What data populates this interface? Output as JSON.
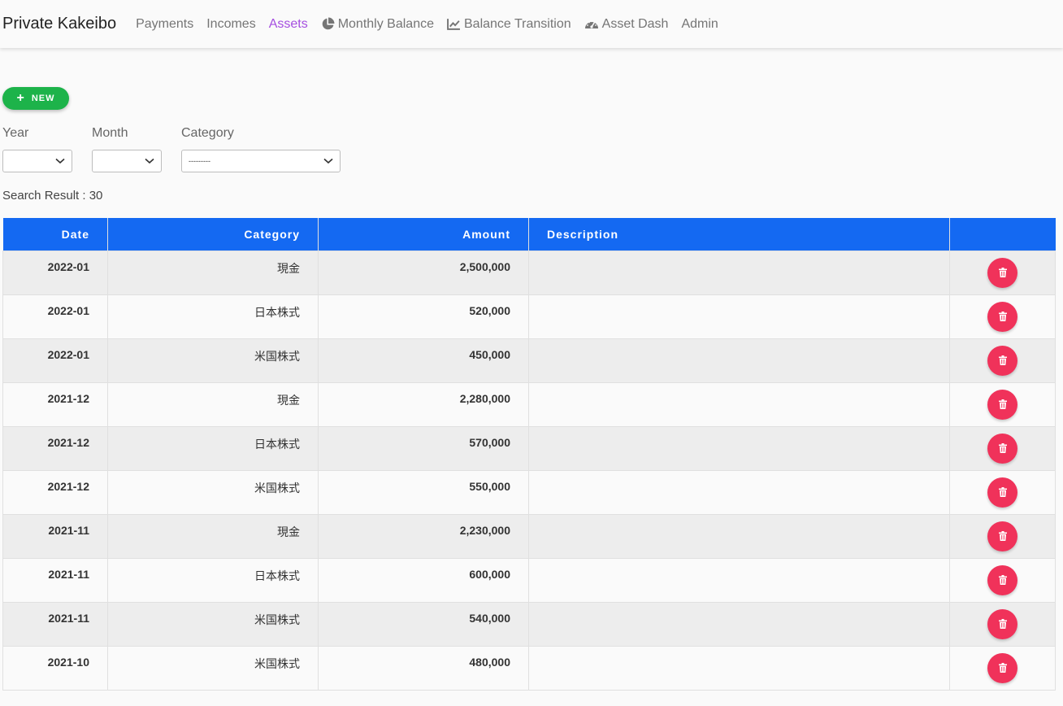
{
  "brand": "Private Kakeibo",
  "nav": [
    {
      "label": "Payments",
      "icon": "",
      "active": false
    },
    {
      "label": "Incomes",
      "icon": "",
      "active": false
    },
    {
      "label": "Assets",
      "icon": "",
      "active": true
    },
    {
      "label": "Monthly Balance",
      "icon": "pie-chart-icon",
      "active": false
    },
    {
      "label": "Balance Transition",
      "icon": "line-chart-icon",
      "active": false
    },
    {
      "label": "Asset Dash",
      "icon": "dashboard-icon",
      "active": false
    },
    {
      "label": "Admin",
      "icon": "",
      "active": false
    }
  ],
  "new_button": {
    "label": "NEW"
  },
  "filters": {
    "year": {
      "label": "Year",
      "value": ""
    },
    "month": {
      "label": "Month",
      "value": ""
    },
    "category": {
      "label": "Category",
      "value": "---------"
    }
  },
  "search_result": "Search Result : 30",
  "table": {
    "headers": [
      "Date",
      "Category",
      "Amount",
      "Description",
      ""
    ],
    "rows": [
      {
        "date": "2022-01",
        "category": "現金",
        "amount": "2,500,000",
        "description": ""
      },
      {
        "date": "2022-01",
        "category": "日本株式",
        "amount": "520,000",
        "description": ""
      },
      {
        "date": "2022-01",
        "category": "米国株式",
        "amount": "450,000",
        "description": ""
      },
      {
        "date": "2021-12",
        "category": "現金",
        "amount": "2,280,000",
        "description": ""
      },
      {
        "date": "2021-12",
        "category": "日本株式",
        "amount": "570,000",
        "description": ""
      },
      {
        "date": "2021-12",
        "category": "米国株式",
        "amount": "550,000",
        "description": ""
      },
      {
        "date": "2021-11",
        "category": "現金",
        "amount": "2,230,000",
        "description": ""
      },
      {
        "date": "2021-11",
        "category": "日本株式",
        "amount": "600,000",
        "description": ""
      },
      {
        "date": "2021-11",
        "category": "米国株式",
        "amount": "540,000",
        "description": ""
      },
      {
        "date": "2021-10",
        "category": "米国株式",
        "amount": "480,000",
        "description": ""
      }
    ]
  },
  "colors": {
    "header_bg": "#1469f2",
    "active_nav": "#a54ee0",
    "new_button": "#1db34a",
    "delete_button": "#f0325a"
  }
}
